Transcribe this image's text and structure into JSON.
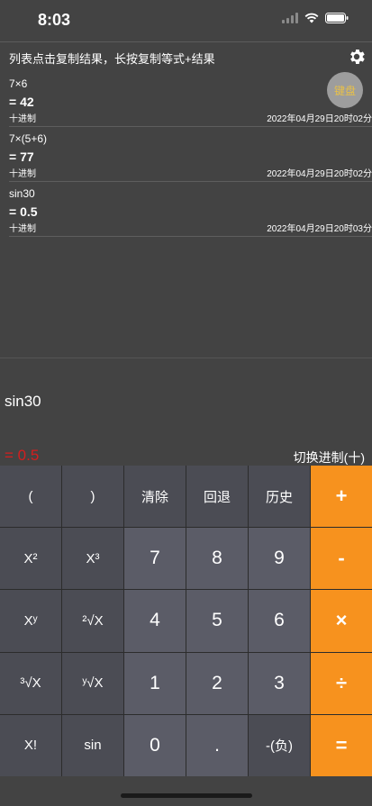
{
  "status": {
    "time": "8:03"
  },
  "header": {
    "hint": "列表点击复制结果，长按复制等式+结果",
    "keyboard_badge": "键盘"
  },
  "history": [
    {
      "expr": "7×6",
      "result": "= 42",
      "base": "十进制",
      "time": "2022年04月29日20时02分"
    },
    {
      "expr": "7×(5+6)",
      "result": "= 77",
      "base": "十进制",
      "time": "2022年04月29日20时02分"
    },
    {
      "expr": "sin30",
      "result": "= 0.5",
      "base": "十进制",
      "time": "2022年04月29日20时03分"
    }
  ],
  "display": {
    "expression": "sin30",
    "result": "= 0.5",
    "base_toggle": "切换进制(十)"
  },
  "keys": [
    [
      "(",
      ")",
      "清除",
      "回退",
      "历史",
      "+"
    ],
    [
      "X²",
      "X³",
      "7",
      "8",
      "9",
      "-"
    ],
    [
      "Xʸ",
      "²√X",
      "4",
      "5",
      "6",
      "×"
    ],
    [
      "³√X",
      "ʸ√X",
      "1",
      "2",
      "3",
      "÷"
    ],
    [
      "X!",
      "sin",
      "0",
      ".",
      "-(负)",
      "="
    ]
  ],
  "colors": {
    "accent": "#f7921e",
    "result_red": "#d41e1e",
    "badge_text": "#e8c048"
  }
}
